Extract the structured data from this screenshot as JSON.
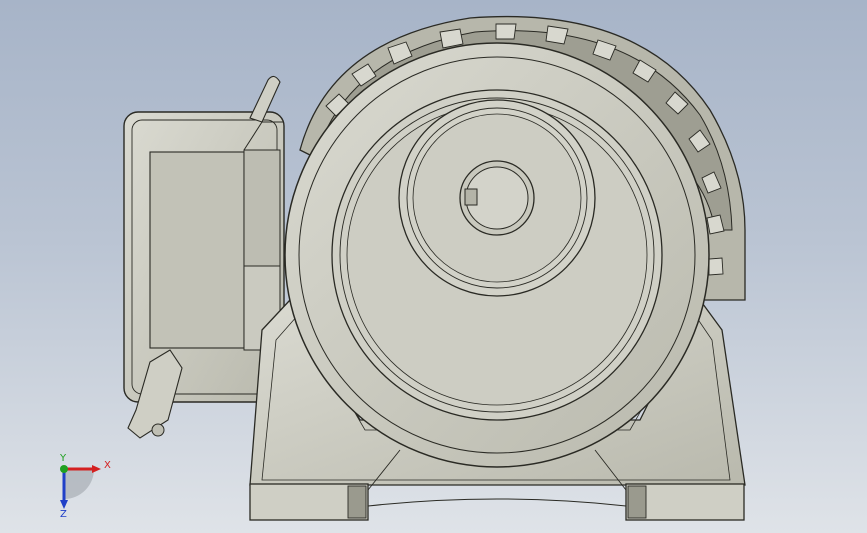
{
  "viewport": {
    "background_top": "#a7b4c8",
    "background_bottom": "#dfe3e8",
    "model_fill": "#cdcdc3",
    "model_shade": "#a9a99d",
    "model_stroke": "#2a2a24"
  },
  "triad": {
    "x_label": "X",
    "y_label": "Y",
    "z_label": "Z",
    "x_color": "#d42020",
    "y_color": "#20a020",
    "z_color": "#2040c8"
  }
}
